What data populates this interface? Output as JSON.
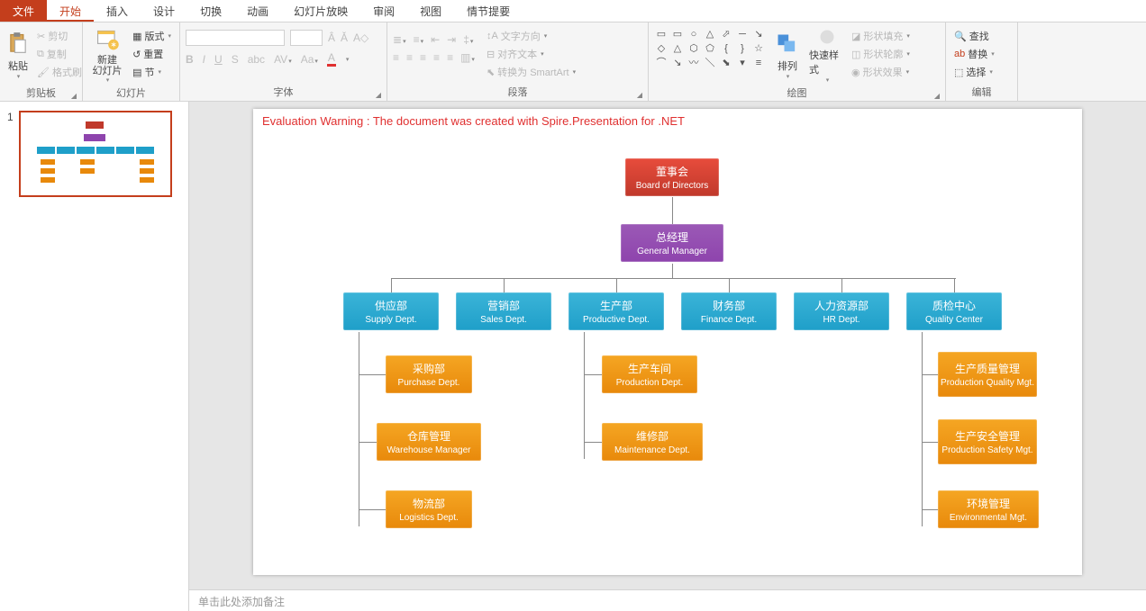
{
  "tabs": {
    "file": "文件",
    "home": "开始",
    "insert": "插入",
    "design": "设计",
    "transition": "切换",
    "animation": "动画",
    "slideshow": "幻灯片放映",
    "review": "审阅",
    "view": "视图",
    "storyboard": "情节提要"
  },
  "ribbon": {
    "clipboard": {
      "paste": "粘贴",
      "cut": "剪切",
      "copy": "复制",
      "formatpainter": "格式刷",
      "label": "剪贴板"
    },
    "slides": {
      "newslide": "新建\n幻灯片",
      "layout": "版式",
      "reset": "重置",
      "section": "节",
      "label": "幻灯片"
    },
    "font": {
      "label": "字体"
    },
    "paragraph": {
      "textdir": "文字方向",
      "align": "对齐文本",
      "smartart": "转换为 SmartArt",
      "label": "段落"
    },
    "drawing": {
      "arrange": "排列",
      "quickstyles": "快速样式",
      "shapefill": "形状填充",
      "shapeoutline": "形状轮廓",
      "shapeeffects": "形状效果",
      "label": "绘图"
    },
    "editing": {
      "find": "查找",
      "replace": "替换",
      "select": "选择",
      "label": "编辑"
    }
  },
  "thumb_number": "1",
  "warning": "Evaluation Warning : The document was created with  Spire.Presentation for .NET",
  "org": {
    "board": {
      "cn": "董事会",
      "en": "Board of Directors"
    },
    "gm": {
      "cn": "总经理",
      "en": "General Manager"
    },
    "depts": {
      "supply": {
        "cn": "供应部",
        "en": "Supply Dept."
      },
      "sales": {
        "cn": "营销部",
        "en": "Sales Dept."
      },
      "prod": {
        "cn": "生产部",
        "en": "Productive Dept."
      },
      "finance": {
        "cn": "财务部",
        "en": "Finance Dept."
      },
      "hr": {
        "cn": "人力资源部",
        "en": "HR Dept."
      },
      "quality": {
        "cn": "质检中心",
        "en": "Quality Center"
      }
    },
    "subs": {
      "purchase": {
        "cn": "采购部",
        "en": "Purchase Dept."
      },
      "warehouse": {
        "cn": "仓库管理",
        "en": "Warehouse Manager"
      },
      "logistics": {
        "cn": "物流部",
        "en": "Logistics Dept."
      },
      "production": {
        "cn": "生产车间",
        "en": "Production Dept."
      },
      "maintenance": {
        "cn": "维修部",
        "en": "Maintenance Dept."
      },
      "pqm": {
        "cn": "生产质量管理",
        "en": "Production Quality Mgt."
      },
      "psm": {
        "cn": "生产安全管理",
        "en": "Production Safety Mgt."
      },
      "env": {
        "cn": "环境管理",
        "en": "Environmental Mgt."
      }
    }
  },
  "notes_placeholder": "单击此处添加备注"
}
